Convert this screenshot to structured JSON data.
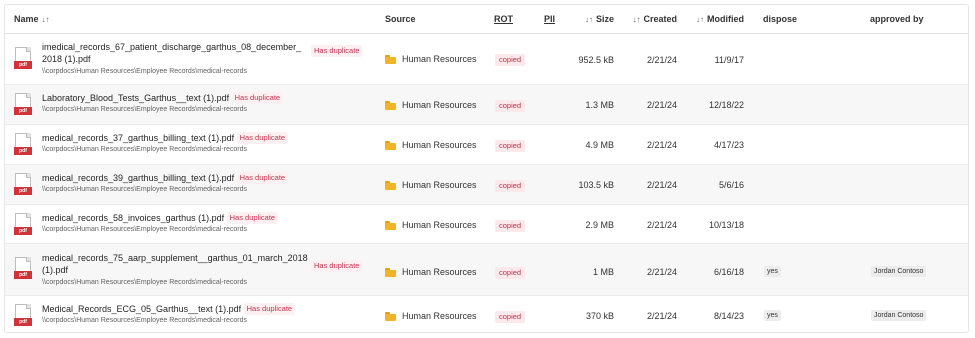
{
  "columns": {
    "name": "Name",
    "source": "Source",
    "rot": "ROT",
    "pii": "PII",
    "size": "Size",
    "created": "Created",
    "modified": "Modified",
    "dispose": "dispose",
    "approved_by": "approved by"
  },
  "sort_icons": {
    "name": "↓↑",
    "size": "↓↑",
    "created": "↓↑",
    "modified": "↓↑"
  },
  "icons": {
    "file": "pdf-file-icon",
    "folder": "folder-icon",
    "file_badge": "pdf"
  },
  "colors": {
    "duplicate_badge": "#c4314b",
    "rot_badge": "#c4314b",
    "pdf_icon": "#d13438",
    "folder": "#f0b429"
  },
  "rows": [
    {
      "name_line1": "imedical_records_67_patient_discharge_garthus_08_december_",
      "name_line2": "2018 (1).pdf",
      "duplicate": "Has duplicate",
      "path": "\\\\corpdocs\\Human Resources\\Employee Records\\medical-records",
      "source": "Human Resources",
      "rot": "copied",
      "size": "952.5 kB",
      "created": "2/21/24",
      "modified": "11/9/17",
      "dispose": "",
      "approved_by": ""
    },
    {
      "name_line1": "Laboratory_Blood_Tests_Garthus__text (1).pdf",
      "name_line2": "",
      "duplicate": "Has duplicate",
      "path": "\\\\corpdocs\\Human Resources\\Employee Records\\medical-records",
      "source": "Human Resources",
      "rot": "copied",
      "size": "1.3 MB",
      "created": "2/21/24",
      "modified": "12/18/22",
      "dispose": "",
      "approved_by": ""
    },
    {
      "name_line1": "medical_records_37_garthus_billing_text (1).pdf",
      "name_line2": "",
      "duplicate": "Has duplicate",
      "path": "\\\\corpdocs\\Human Resources\\Employee Records\\medical-records",
      "source": "Human Resources",
      "rot": "copied",
      "size": "4.9 MB",
      "created": "2/21/24",
      "modified": "4/17/23",
      "dispose": "",
      "approved_by": ""
    },
    {
      "name_line1": "medical_records_39_garthus_billing_text (1).pdf",
      "name_line2": "",
      "duplicate": "Has duplicate",
      "path": "\\\\corpdocs\\Human Resources\\Employee Records\\medical-records",
      "source": "Human Resources",
      "rot": "copied",
      "size": "103.5 kB",
      "created": "2/21/24",
      "modified": "5/6/16",
      "dispose": "",
      "approved_by": ""
    },
    {
      "name_line1": "medical_records_58_invoices_garthus (1).pdf",
      "name_line2": "",
      "duplicate": "Has duplicate",
      "path": "\\\\corpdocs\\Human Resources\\Employee Records\\medical-records",
      "source": "Human Resources",
      "rot": "copied",
      "size": "2.9 MB",
      "created": "2/21/24",
      "modified": "10/13/18",
      "dispose": "",
      "approved_by": ""
    },
    {
      "name_line1": "medical_records_75_aarp_supplement__garthus_01_march_2018",
      "name_line2": "(1).pdf",
      "duplicate": "Has duplicate",
      "path": "\\\\corpdocs\\Human Resources\\Employee Records\\medical-records",
      "source": "Human Resources",
      "rot": "copied",
      "size": "1 MB",
      "created": "2/21/24",
      "modified": "6/16/18",
      "dispose": "yes",
      "approved_by": "Jordan Contoso"
    },
    {
      "name_line1": "Medical_Records_ECG_05_Garthus__text (1).pdf",
      "name_line2": "",
      "duplicate": "Has duplicate",
      "path": "\\\\corpdocs\\Human Resources\\Employee Records\\medical-records",
      "source": "Human Resources",
      "rot": "copied",
      "size": "370 kB",
      "created": "2/21/24",
      "modified": "8/14/23",
      "dispose": "yes",
      "approved_by": "Jordan Contoso"
    }
  ]
}
